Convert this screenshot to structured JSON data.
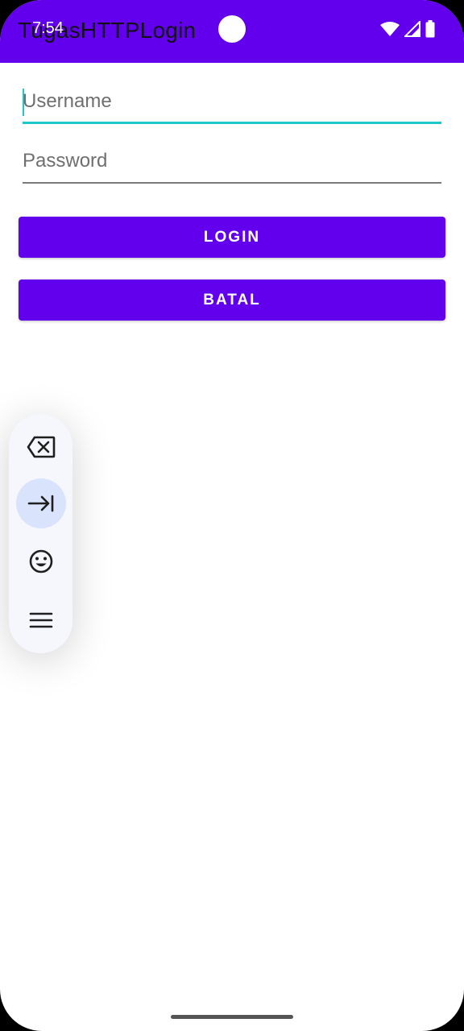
{
  "status_bar": {
    "time": "7:54",
    "icons": [
      "wifi-icon",
      "signal-icon",
      "battery-icon"
    ]
  },
  "app_bar": {
    "title": "TugasHTTPLogin",
    "color": "#6200ee"
  },
  "form": {
    "username_placeholder": "Username",
    "password_placeholder": "Password",
    "focus_color": "#1fc7c7"
  },
  "buttons": {
    "login_label": "LOGIN",
    "cancel_label": "BATAL"
  },
  "floating_toolbar": {
    "items": [
      "backspace-icon",
      "tab-icon",
      "emoji-icon",
      "menu-icon"
    ],
    "active_item": "tab-icon"
  }
}
